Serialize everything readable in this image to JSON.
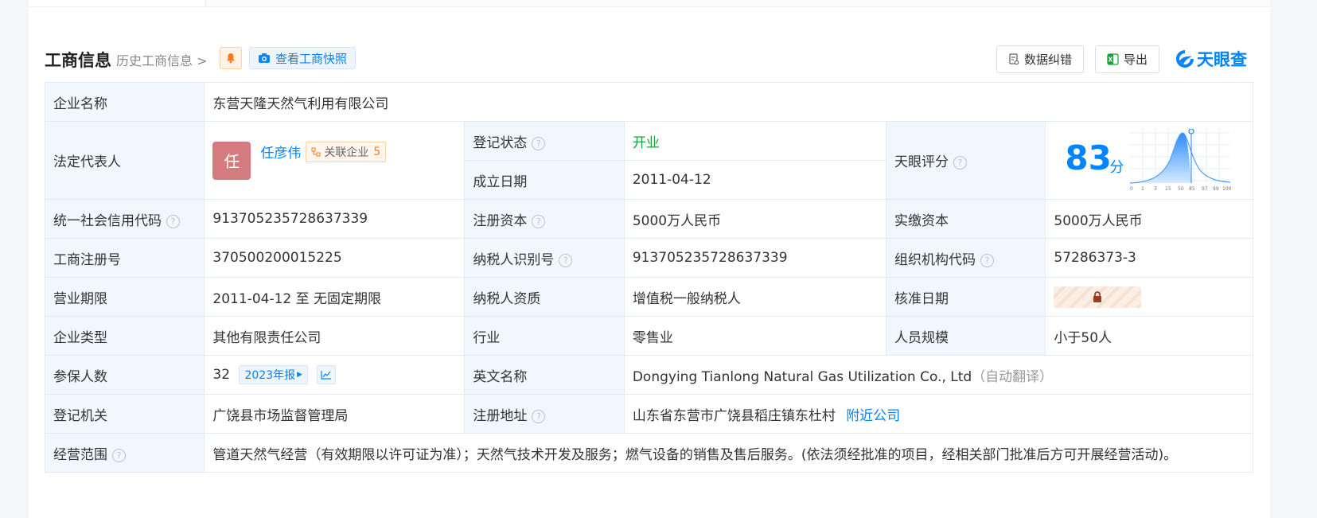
{
  "header": {
    "title": "工商信息",
    "history_link": "历史工商信息",
    "snapshot_button": "查看工商快照",
    "correction_button": "数据纠错",
    "export_button": "导出",
    "brand": "天眼查"
  },
  "company": {
    "name_label": "企业名称",
    "name": "东营天隆天然气利用有限公司",
    "legal_label": "法定代表人",
    "legal_avatar": "任",
    "legal_name": "任彦伟",
    "related_label": "关联企业",
    "related_count": "5",
    "status_label": "登记状态",
    "status": "开业",
    "founded_label": "成立日期",
    "founded": "2011-04-12",
    "score_label": "天眼评分",
    "score": "83",
    "score_unit": "分",
    "score_axis": [
      "0",
      "1",
      "3",
      "15",
      "50",
      "85",
      "97",
      "99",
      "100"
    ],
    "credit_label": "统一社会信用代码",
    "credit_code": "913705235728637339",
    "capital_label": "注册资本",
    "capital": "5000万人民币",
    "paid_label": "实缴资本",
    "paid": "5000万人民币",
    "reg_no_label": "工商注册号",
    "reg_no": "370500200015225",
    "tax_id_label": "纳税人识别号",
    "tax_id": "913705235728637339",
    "org_code_label": "组织机构代码",
    "org_code": "57286373-3",
    "term_label": "营业期限",
    "term": "2011-04-12 至 无固定期限",
    "tax_qual_label": "纳税人资质",
    "tax_qual": "增值税一般纳税人",
    "approve_label": "核准日期",
    "type_label": "企业类型",
    "type": "其他有限责任公司",
    "industry_label": "行业",
    "industry": "零售业",
    "staff_label": "人员规模",
    "staff": "小于50人",
    "insured_label": "参保人数",
    "insured": "32",
    "report_year": "2023年报",
    "en_label": "英文名称",
    "en_name": "Dongying Tianlong Natural Gas Utilization Co., Ltd",
    "auto_translate": "（自动翻译）",
    "authority_label": "登记机关",
    "authority": "广饶县市场监督管理局",
    "address_label": "注册地址",
    "address": "山东省东营市广饶县稻庄镇东杜村",
    "nearby": "附近公司",
    "scope_label": "经营范围",
    "scope": "管道天然气经营（有效期限以许可证为准）；天然气技术开发及服务；燃气设备的销售及售后服务。(依法须经批准的项目，经相关部门批准后方可开展经营活动)。"
  },
  "colors": {
    "accent": "#0084ff",
    "label_bg": "#f1f7ff",
    "status_green": "#1d9f3b",
    "avatar": "#d37b7e"
  }
}
